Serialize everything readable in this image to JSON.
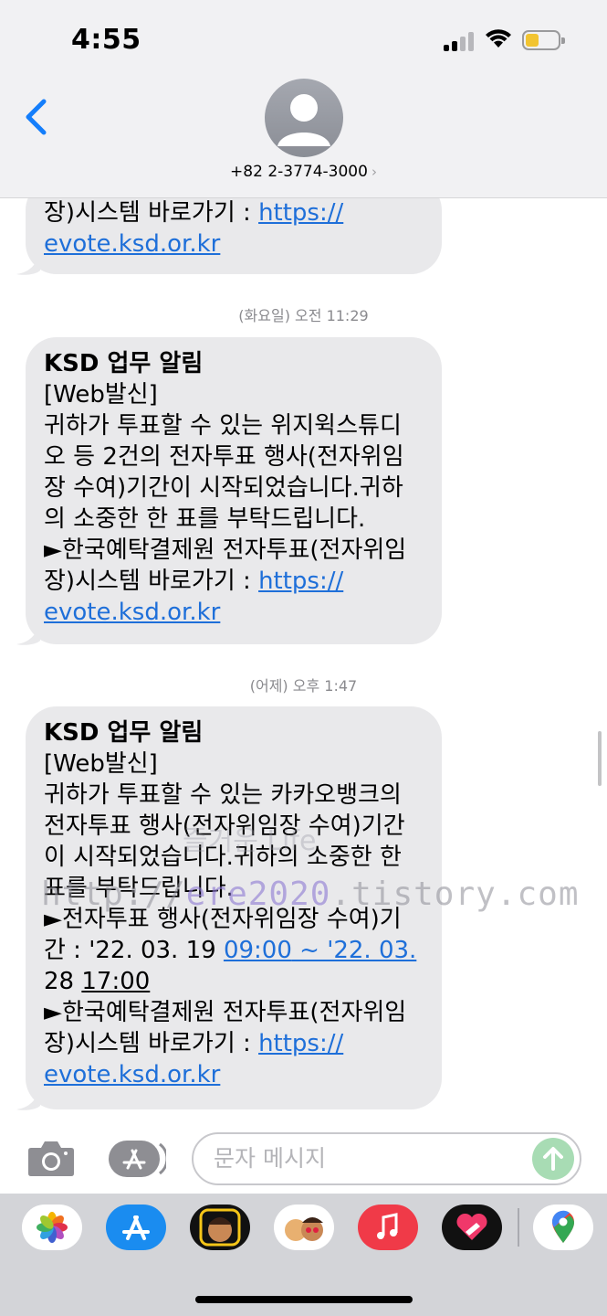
{
  "status_bar": {
    "time": "4:55"
  },
  "header": {
    "contact": "+82 2-3774-3000",
    "chevron": "›"
  },
  "messages": [
    {
      "lines": [
        "장)시스템 바로가기 : "
      ],
      "link1": "https://",
      "link2": "evote.ksd.or.kr"
    },
    {
      "timestamp_day": "(화요일)",
      "timestamp_time": "오전 11:29",
      "title": "KSD 업무 알림",
      "lines": [
        "[Web발신]",
        "귀하가 투표할 수 있는 위지윅스튜디",
        "오 등 2건의 전자투표 행사(전자위임",
        "장 수여)기간이 시작되었습니다.귀하",
        "의 소중한 한 표를 부탁드립니다.",
        "►한국예탁결제원 전자투표(전자위임",
        "장)시스템 바로가기 : "
      ],
      "link1": "https://",
      "link2": "evote.ksd.or.kr"
    },
    {
      "timestamp_day": "(어제)",
      "timestamp_time": "오후 1:47",
      "title": "KSD 업무 알림",
      "lines": [
        "[Web발신]",
        "귀하가 투표할 수 있는 카카오뱅크의",
        "전자투표 행사(전자위임장 수여)기간",
        "이 시작되었습니다.귀하의 소중한 한",
        "표를 부탁드립니다.",
        "►전자투표 행사(전자위임장 수여)기",
        "간 : '22. 03. 19 ",
        "28 ",
        "►한국예탁결제원 전자투표(전자위임",
        "장)시스템 바로가기 : "
      ],
      "date1_time": "09:00",
      "date1_rest": " ~ '22. 03.",
      "date2_time": "17:00",
      "link1": "https://",
      "link2": "evote.ksd.or.kr"
    }
  ],
  "watermark": {
    "left": "http://",
    "mid": "ere2020",
    "right": ".tistory.com",
    "faint": "즐거운 Life"
  },
  "composer": {
    "placeholder": "문자 메시지"
  },
  "icons": {
    "back": "chevron-left-icon",
    "camera": "camera-icon",
    "apps": "app-store-icon",
    "send": "send-arrow-icon"
  },
  "colors": {
    "link": "#1e6fd9",
    "bubble": "#e9e9eb",
    "accent": "#147efb",
    "battery": "#f2c431"
  }
}
